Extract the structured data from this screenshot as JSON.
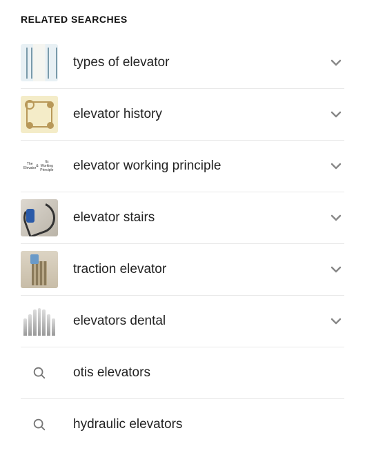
{
  "heading": "RELATED SEARCHES",
  "items": [
    {
      "label": "types of elevator",
      "has_thumb": true,
      "has_chevron": true
    },
    {
      "label": "elevator history",
      "has_thumb": true,
      "has_chevron": true
    },
    {
      "label": "elevator working principle",
      "has_thumb": true,
      "has_chevron": true,
      "thumb_text_title": "The Elevator",
      "thumb_text_amp": "&",
      "thumb_text_sub": "Its Working Principle"
    },
    {
      "label": "elevator stairs",
      "has_thumb": true,
      "has_chevron": true
    },
    {
      "label": "traction elevator",
      "has_thumb": true,
      "has_chevron": true
    },
    {
      "label": "elevators dental",
      "has_thumb": true,
      "has_chevron": true
    },
    {
      "label": "otis elevators",
      "has_thumb": false,
      "has_chevron": false
    },
    {
      "label": "hydraulic elevators",
      "has_thumb": false,
      "has_chevron": false
    }
  ]
}
